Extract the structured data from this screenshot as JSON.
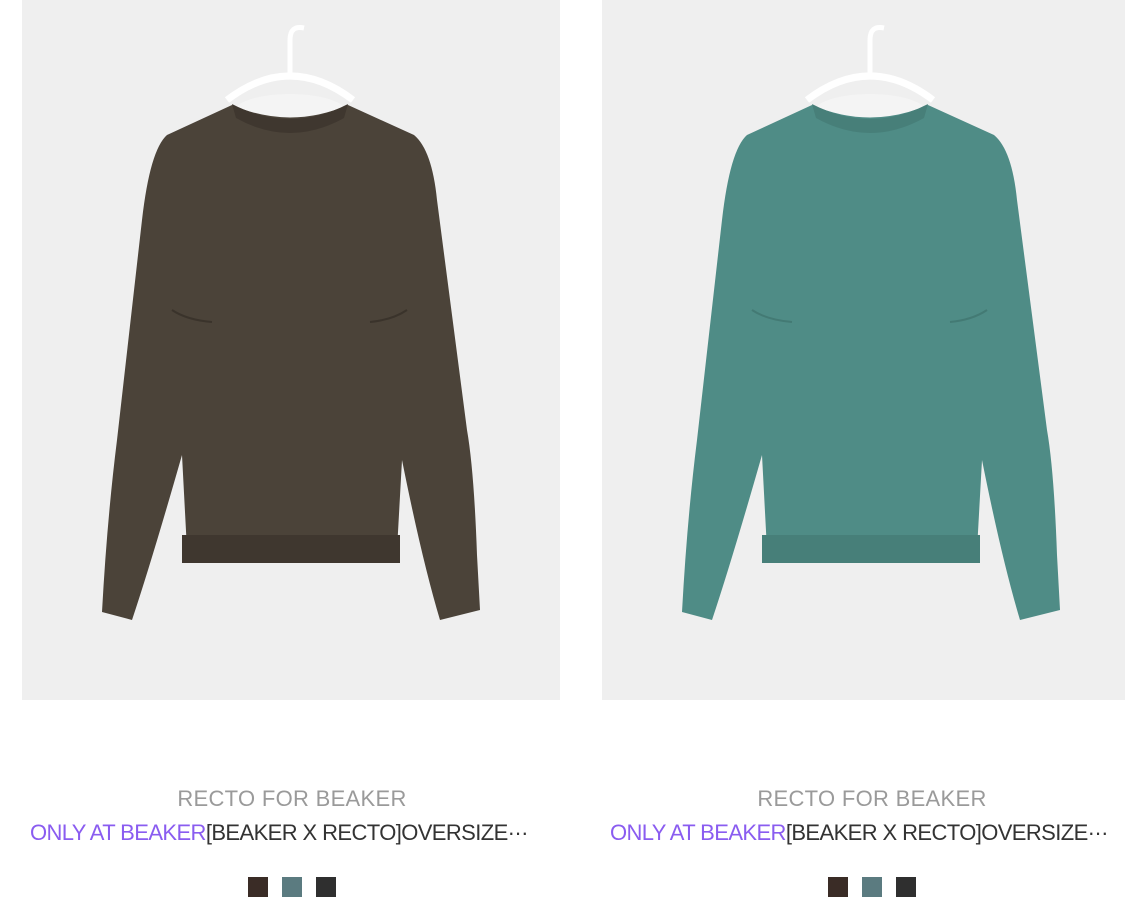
{
  "products": [
    {
      "brand": "RECTO FOR BEAKER",
      "tag": "ONLY AT BEAKER",
      "name": "[BEAKER X RECTO]OVERSIZE···",
      "garment_color": "#4b4339",
      "rib_color": "#3f372f",
      "swatches": [
        "#3a2c26",
        "#5b7b80",
        "#2f2f2f"
      ]
    },
    {
      "brand": "RECTO FOR BEAKER",
      "tag": "ONLY AT BEAKER",
      "name": "[BEAKER X RECTO]OVERSIZE···",
      "garment_color": "#4f8c86",
      "rib_color": "#477f79",
      "swatches": [
        "#3a2c26",
        "#5b7b80",
        "#2f2f2f"
      ]
    }
  ]
}
